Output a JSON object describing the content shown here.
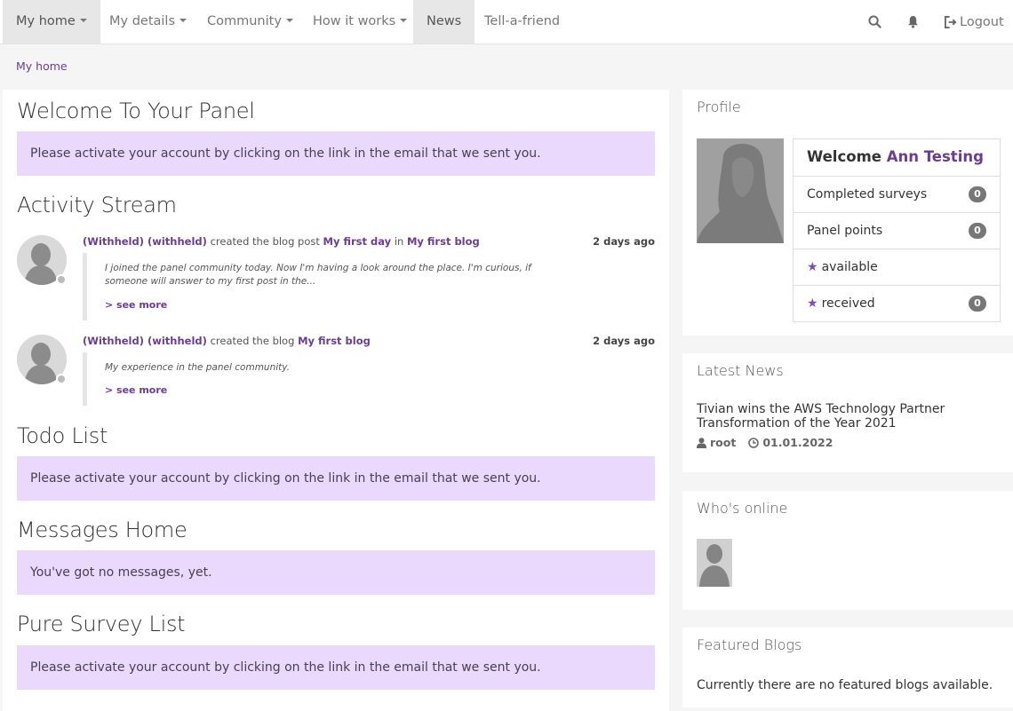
{
  "nav": {
    "my_home": "My home",
    "my_details": "My details",
    "community": "Community",
    "how_it_works": "How it works",
    "news": "News",
    "tell_a_friend": "Tell-a-friend",
    "logout": "Logout"
  },
  "breadcrumb": "My home",
  "main": {
    "welcome_title": "Welcome To Your Panel",
    "activate_msg": "Please activate your account by clicking on the link in the email that we sent you.",
    "activity_title": "Activity Stream",
    "activities": [
      {
        "user": "(Withheld) (withheld)",
        "action": " created the blog post ",
        "target": "My first day",
        "in": " in ",
        "blog": "My first blog",
        "time": "2 days ago",
        "text": "I joined the panel community today. Now I'm having a look around the place. I'm curious, if someone will answer to my first post in the...",
        "see_more": "> see more"
      },
      {
        "user": "(Withheld) (withheld)",
        "action": " created the blog ",
        "target": "My first blog",
        "time": "2 days ago",
        "text": "My experience in the panel community.",
        "see_more": "> see more"
      }
    ],
    "todo_title": "Todo List",
    "todo_msg": "Please activate your account by clicking on the link in the email that we sent you.",
    "messages_title": "Messages Home",
    "messages_msg": "You've got no messages, yet.",
    "survey_title": "Pure Survey List",
    "survey_msg": "Please activate your account by clicking on the link in the email that we sent you."
  },
  "sidebar": {
    "profile_title": "Profile",
    "welcome_prefix": "Welcome",
    "user_name": "Ann Testing",
    "stats": [
      {
        "label": "Completed surveys",
        "value": "0"
      },
      {
        "label": "Panel points",
        "value": "0"
      },
      {
        "label": "available",
        "value": ""
      },
      {
        "label": "received",
        "value": "0"
      }
    ],
    "news_title": "Latest News",
    "news_item": "Tivian wins the AWS Technology Partner Transformation of the Year 2021",
    "news_author": "root",
    "news_date": "01.01.2022",
    "online_title": "Who's online",
    "featured_title": "Featured Blogs",
    "featured_text": "Currently there are no featured blogs available."
  },
  "colors": {
    "accent": "#6b3d8f",
    "alert_bg": "#ead9fc",
    "star": "#7a4cc2"
  }
}
